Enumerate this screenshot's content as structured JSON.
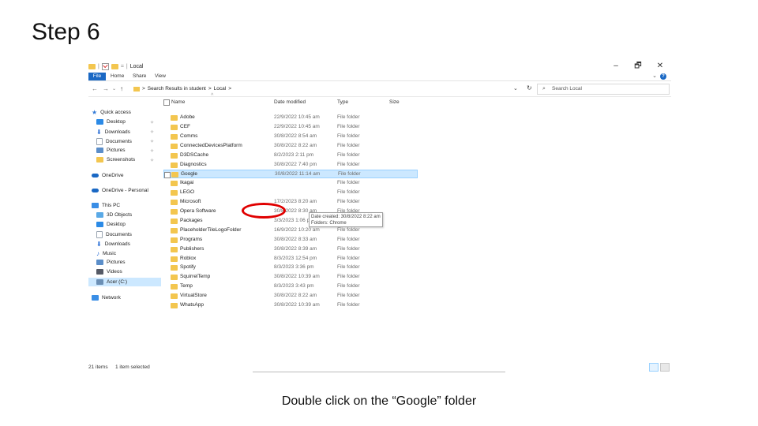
{
  "slide": {
    "title": "Step 6",
    "caption": "Double click on the “Google” folder"
  },
  "window": {
    "title": "Local",
    "quick_access_sep": "=",
    "controls": {
      "minimize": "–",
      "maximize": "🗗",
      "close": "✕"
    },
    "ribbon_tabs": [
      "File",
      "Home",
      "Share",
      "View"
    ],
    "help_label": "?",
    "ribbon_chevron": "⌄",
    "nav": {
      "back": "←",
      "forward": "→",
      "recent": "⌄",
      "up": "↑"
    },
    "address": {
      "sep": ">",
      "crumbs": [
        "Search Results in student",
        "Local"
      ],
      "dropdown": "⌄",
      "refresh": "↻"
    },
    "search": {
      "placeholder": "Search Local",
      "icon": "search-icon"
    },
    "sidebar": [
      {
        "label": "Quick access",
        "icon": "star-icon",
        "color": "#2f78d6"
      },
      {
        "label": "Desktop",
        "icon": "desktop-icon",
        "color": "#2b8ae6",
        "pinned": true
      },
      {
        "label": "Downloads",
        "icon": "download-icon",
        "color": "#2b6fd6",
        "pinned": true
      },
      {
        "label": "Documents",
        "icon": "document-icon",
        "color": "#9aa5b1",
        "pinned": true
      },
      {
        "label": "Pictures",
        "icon": "pictures-icon",
        "color": "#5b8ec9",
        "pinned": true
      },
      {
        "label": "Screenshots",
        "icon": "folder-icon",
        "color": "#f3c64f",
        "pinned": true
      },
      {
        "label": "OneDrive",
        "icon": "cloud-icon",
        "color": "#1a68c4"
      },
      {
        "label": "OneDrive - Personal",
        "icon": "cloud-icon",
        "color": "#1a68c4"
      },
      {
        "label": "This PC",
        "icon": "pc-icon",
        "color": "#3a8ee6"
      },
      {
        "label": "3D Objects",
        "icon": "cube-icon",
        "color": "#5aa9e6"
      },
      {
        "label": "Desktop",
        "icon": "desktop-icon",
        "color": "#2b8ae6"
      },
      {
        "label": "Documents",
        "icon": "document-icon",
        "color": "#9aa5b1"
      },
      {
        "label": "Downloads",
        "icon": "download-icon",
        "color": "#2b6fd6"
      },
      {
        "label": "Music",
        "icon": "music-icon",
        "color": "#2b6fd6"
      },
      {
        "label": "Pictures",
        "icon": "pictures-icon",
        "color": "#5b8ec9"
      },
      {
        "label": "Videos",
        "icon": "video-icon",
        "color": "#555a66"
      },
      {
        "label": "Acer (C:)",
        "icon": "drive-icon",
        "color": "#6b8fb5",
        "selected": true
      },
      {
        "label": "Network",
        "icon": "network-icon",
        "color": "#3a8ee6"
      }
    ],
    "pin_glyph": "✧",
    "columns": [
      "Name",
      "Date modified",
      "Type",
      "Size"
    ],
    "sort_glyph": "^",
    "files": [
      {
        "name": "Adobe",
        "date": "22/9/2022 10:45 am",
        "type": "File folder"
      },
      {
        "name": "CEF",
        "date": "22/9/2022 10:45 am",
        "type": "File folder"
      },
      {
        "name": "Comms",
        "date": "30/8/2022 8:54 am",
        "type": "File folder"
      },
      {
        "name": "ConnectedDevicesPlatform",
        "date": "30/8/2022 8:22 am",
        "type": "File folder"
      },
      {
        "name": "D3DSCache",
        "date": "8/2/2023 2:11 pm",
        "type": "File folder"
      },
      {
        "name": "Diagnostics",
        "date": "30/8/2022 7:40 pm",
        "type": "File folder"
      },
      {
        "name": "Google",
        "date": "30/8/2022 11:14 am",
        "type": "File folder",
        "selected": true
      },
      {
        "name": "Ikagai",
        "date": "",
        "type": "File folder"
      },
      {
        "name": "LEGO",
        "date": "",
        "type": "File folder"
      },
      {
        "name": "Microsoft",
        "date": "17/2/2023 8:20 am",
        "type": "File folder"
      },
      {
        "name": "Opera Software",
        "date": "30/8/2022 8:30 am",
        "type": "File folder"
      },
      {
        "name": "Packages",
        "date": "3/3/2023 1:06 pm",
        "type": "File folder"
      },
      {
        "name": "PlaceholderTileLogoFolder",
        "date": "16/9/2022 10:20 am",
        "type": "File folder"
      },
      {
        "name": "Programs",
        "date": "30/8/2022 8:33 am",
        "type": "File folder"
      },
      {
        "name": "Publishers",
        "date": "30/8/2022 8:39 am",
        "type": "File folder"
      },
      {
        "name": "Roblox",
        "date": "8/3/2023 12:54 pm",
        "type": "File folder"
      },
      {
        "name": "Spotify",
        "date": "8/3/2023 3:36 pm",
        "type": "File folder"
      },
      {
        "name": "SquirrelTemp",
        "date": "30/8/2022 10:39 am",
        "type": "File folder"
      },
      {
        "name": "Temp",
        "date": "8/3/2023 3:43 pm",
        "type": "File folder"
      },
      {
        "name": "VirtualStore",
        "date": "30/8/2022 8:22 am",
        "type": "File folder"
      },
      {
        "name": "WhatsApp",
        "date": "30/8/2022 10:39 am",
        "type": "File folder"
      }
    ],
    "tooltip": {
      "line1": "Date created: 30/8/2022 8:22 am",
      "line2": "Folders: Chrome"
    },
    "status": {
      "count": "21 items",
      "selection": "1 item selected"
    }
  }
}
